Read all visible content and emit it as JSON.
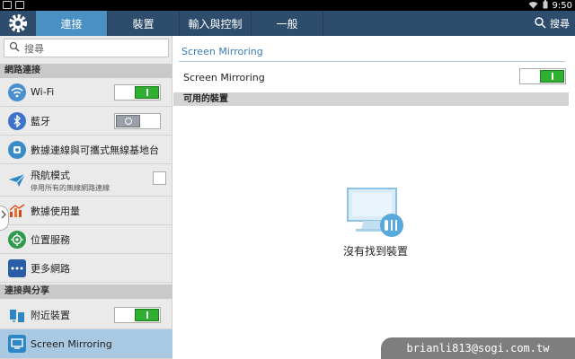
{
  "status": {
    "time": "9:50"
  },
  "tabs": [
    {
      "label": "連接"
    },
    {
      "label": "裝置"
    },
    {
      "label": "輸入與控制"
    },
    {
      "label": "一般"
    }
  ],
  "tab_search_label": "搜尋",
  "sidebar": {
    "search_placeholder": "搜尋",
    "sections": {
      "network": "網路連接",
      "share": "連接與分享"
    },
    "items": [
      {
        "label": "Wi-Fi"
      },
      {
        "label": "藍牙"
      },
      {
        "label": "數據連線與可攜式無線基地台"
      },
      {
        "label": "飛航模式",
        "sub": "停用所有的無線網路連線"
      },
      {
        "label": "數據使用量"
      },
      {
        "label": "位置服務"
      },
      {
        "label": "更多網路"
      },
      {
        "label": "附近裝置"
      },
      {
        "label": "Screen Mirroring"
      }
    ]
  },
  "main": {
    "title": "Screen Mirroring",
    "row_label": "Screen Mirroring",
    "section": "可用的裝置",
    "empty_text": "沒有找到裝置"
  },
  "watermark": "brianli813@sogi.com.tw",
  "colors": {
    "accent": "#4b90c2",
    "tabbar": "#2e4d6c",
    "switch_on": "#30b030"
  }
}
